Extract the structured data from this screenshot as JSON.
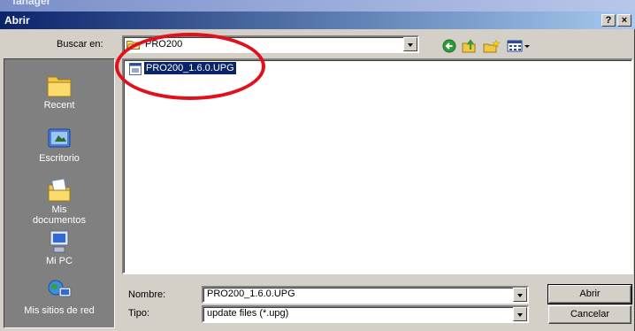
{
  "behind_title": "fanager",
  "dialog": {
    "title": "Abrir",
    "help_button": "?",
    "close_button": "×"
  },
  "lookin": {
    "label": "Buscar en:",
    "value": "PRO200"
  },
  "toolbar": {
    "back": "back-icon",
    "up": "up-folder-icon",
    "new_folder": "new-folder-icon",
    "views": "views-menu-icon"
  },
  "places": [
    {
      "label": "Recent",
      "icon": "recent-icon"
    },
    {
      "label": "Escritorio",
      "icon": "desktop-icon"
    },
    {
      "label": "Mis\ndocumentos",
      "icon": "my-documents-icon"
    },
    {
      "label": "Mi PC",
      "icon": "my-computer-icon"
    },
    {
      "label": "Mis sitios de red",
      "icon": "network-places-icon"
    }
  ],
  "files": [
    {
      "name": "PRO200_1.6.0.UPG",
      "selected": true
    }
  ],
  "filename": {
    "label": "Nombre:",
    "value": "PRO200_1.6.0.UPG"
  },
  "filetype": {
    "label": "Tipo:",
    "value": "update files (*.upg)"
  },
  "buttons": {
    "open": "Abrir",
    "cancel": "Cancelar"
  },
  "colors": {
    "selection": "#0a246a",
    "annotation": "#e0101c"
  }
}
